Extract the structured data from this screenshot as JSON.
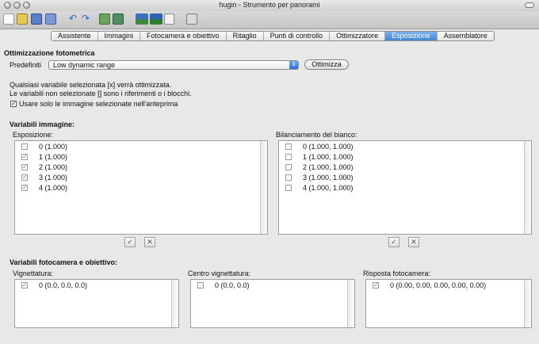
{
  "window": {
    "title": "hugin - Strumento per panorami"
  },
  "tabs": [
    {
      "label": "Assistente",
      "active": false
    },
    {
      "label": "Immagini",
      "active": false
    },
    {
      "label": "Fotocamera e obiettivo",
      "active": false
    },
    {
      "label": "Ritaglio",
      "active": false
    },
    {
      "label": "Punti di controllo",
      "active": false
    },
    {
      "label": "Ottimizzatore",
      "active": false
    },
    {
      "label": "Esposizione",
      "active": true
    },
    {
      "label": "Assemblatore",
      "active": false
    }
  ],
  "photometric": {
    "heading": "Ottimizzazione fotometrica",
    "preset_label": "Predefiniti",
    "preset_value": "Low dynamic range",
    "optimize_button": "Ottimizza",
    "info_line1": "Qualsiasi variabile selezionata [x] verrà ottimizzata.",
    "info_line2": "Le variabili non selezionate [] sono i riferimenti o i blocchi.",
    "only_selected_label": "Usare solo le immagine selezionate nell'anteprima",
    "only_selected_checked": true
  },
  "image_vars": {
    "heading": "Variabili immagine:",
    "exposure": {
      "label": "Esposizione:",
      "items": [
        {
          "label": "0 (1.000)",
          "checked": false
        },
        {
          "label": "1 (1.000)",
          "checked": true
        },
        {
          "label": "2 (1.000)",
          "checked": true
        },
        {
          "label": "3 (1.000)",
          "checked": true
        },
        {
          "label": "4 (1.000)",
          "checked": true
        }
      ]
    },
    "white_balance": {
      "label": "Bilanciamento del bianco:",
      "items": [
        {
          "label": "0 (1.000, 1.000)",
          "checked": false
        },
        {
          "label": "1 (1.000, 1.000)",
          "checked": false
        },
        {
          "label": "2 (1.000, 1.000)",
          "checked": false
        },
        {
          "label": "3 (1.000, 1.000)",
          "checked": false
        },
        {
          "label": "4 (1.000, 1.000)",
          "checked": false
        }
      ]
    },
    "select_all_glyph": "✓",
    "select_none_glyph": "✕"
  },
  "camera_vars": {
    "heading": "Variabili fotocamera e obiettivo:",
    "vignetting": {
      "label": "Vignettatura:",
      "items": [
        {
          "label": "0 (0.0, 0.0, 0.0)",
          "checked": true
        }
      ]
    },
    "vignetting_center": {
      "label": "Centro vignettatura:",
      "items": [
        {
          "label": "0 (0.0, 0.0)",
          "checked": false
        }
      ]
    },
    "camera_response": {
      "label": "Risposta fotocamera:",
      "items": [
        {
          "label": "0 (0.00, 0.00, 0.00, 0.00, 0.00)",
          "checked": true
        }
      ]
    }
  },
  "icons": {
    "toolbar": [
      "new-project-icon",
      "open-project-icon",
      "save-project-icon",
      "save-as-icon",
      "undo-icon",
      "redo-icon",
      "add-image-icon",
      "assistant-icon",
      "preview-icon",
      "fast-preview-icon",
      "gl-preview-icon",
      "optimize-icon"
    ]
  }
}
